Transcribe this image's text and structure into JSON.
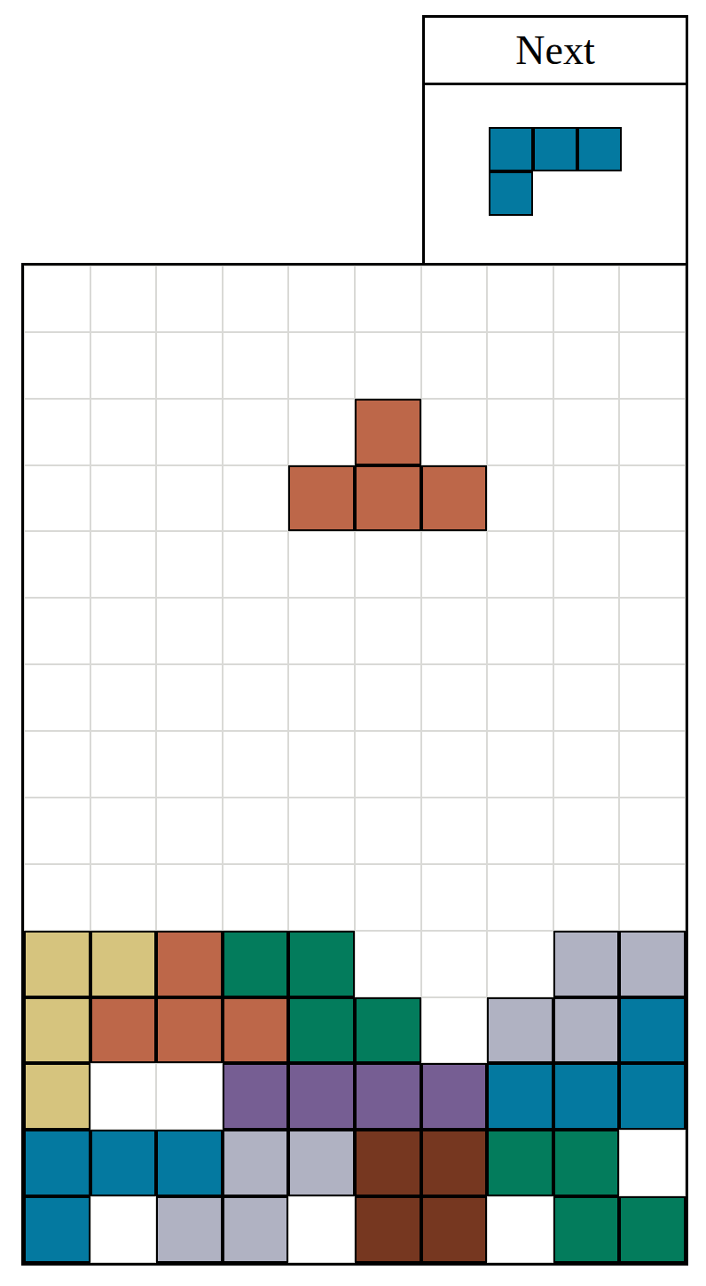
{
  "next": {
    "label": "Next",
    "piece": {
      "color": "#0479A0",
      "rows": 2,
      "cols": 3,
      "cells": [
        [
          0,
          0
        ],
        [
          0,
          1
        ],
        [
          0,
          2
        ],
        [
          1,
          0
        ]
      ]
    }
  },
  "active_piece": {
    "color": "#BD6749",
    "cells": [
      [
        2,
        5
      ],
      [
        3,
        4
      ],
      [
        3,
        5
      ],
      [
        3,
        6
      ]
    ]
  },
  "board": {
    "rows": [
      [
        null,
        null,
        null,
        null,
        null,
        null,
        null,
        null,
        null,
        null
      ],
      [
        null,
        null,
        null,
        null,
        null,
        null,
        null,
        null,
        null,
        null
      ],
      [
        null,
        null,
        null,
        null,
        null,
        null,
        null,
        null,
        null,
        null
      ],
      [
        null,
        null,
        null,
        null,
        null,
        null,
        null,
        null,
        null,
        null
      ],
      [
        null,
        null,
        null,
        null,
        null,
        null,
        null,
        null,
        null,
        null
      ],
      [
        null,
        null,
        null,
        null,
        null,
        null,
        null,
        null,
        null,
        null
      ],
      [
        null,
        null,
        null,
        null,
        null,
        null,
        null,
        null,
        null,
        null
      ],
      [
        null,
        null,
        null,
        null,
        null,
        null,
        null,
        null,
        null,
        null
      ],
      [
        null,
        null,
        null,
        null,
        null,
        null,
        null,
        null,
        null,
        null
      ],
      [
        null,
        null,
        null,
        null,
        null,
        null,
        null,
        null,
        null,
        null
      ],
      [
        "#D6C47E",
        "#D6C47E",
        "#BD6749",
        "#037C5C",
        "#037C5C",
        null,
        null,
        null,
        "#B0B2C2",
        "#B0B2C2"
      ],
      [
        "#D6C47E",
        "#BD6749",
        "#BD6749",
        "#BD6749",
        "#037C5C",
        "#037C5C",
        null,
        "#B0B2C2",
        "#B0B2C2",
        "#0479A0"
      ],
      [
        "#D6C47E",
        null,
        null,
        "#765E93",
        "#765E93",
        "#765E93",
        "#765E93",
        "#0479A0",
        "#0479A0",
        "#0479A0"
      ],
      [
        "#0479A0",
        "#0479A0",
        "#0479A0",
        "#B0B2C2",
        "#B0B2C2",
        "#763720",
        "#763720",
        "#037C5C",
        "#037C5C",
        null
      ],
      [
        "#0479A0",
        null,
        "#B0B2C2",
        "#B0B2C2",
        null,
        "#763720",
        "#763720",
        null,
        "#037C5C",
        "#037C5C"
      ]
    ]
  }
}
